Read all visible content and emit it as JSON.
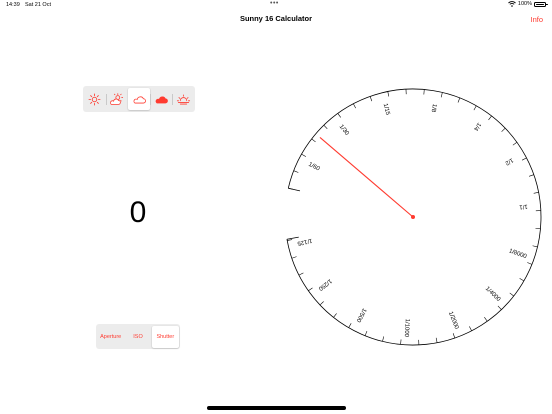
{
  "status_bar": {
    "time": "14:39",
    "date": "Sat 21 Oct",
    "dots": "•••",
    "battery": "100%"
  },
  "nav": {
    "title": "Sunny 16 Calculator",
    "info_label": "Info"
  },
  "colors": {
    "accent": "#ff3b30",
    "background": "#ffffff"
  },
  "weather": {
    "selected_index": 2,
    "options": [
      "sunny-icon",
      "partly-cloudy-icon",
      "cloudy-icon",
      "overcast-icon",
      "sunset-icon"
    ]
  },
  "result": {
    "value": "0"
  },
  "mode": {
    "selected_index": 2,
    "options": [
      "Aperture",
      "ISO",
      "Shutter"
    ]
  },
  "dial": {
    "labels_clockwise": [
      "1/60",
      "1/30",
      "1/15",
      "1/8",
      "1/4",
      "1/2",
      "1/1",
      "1/8000",
      "1/4000",
      "1/2000",
      "1/1000",
      "1/500",
      "1/250",
      "1/125"
    ],
    "pointer_label": "1/60"
  }
}
